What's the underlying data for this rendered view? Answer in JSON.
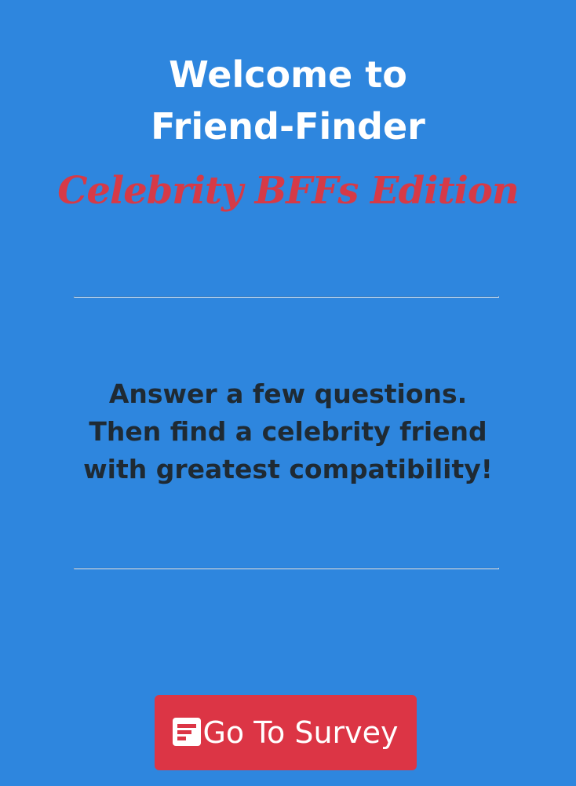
{
  "header": {
    "title_line1": "Welcome to",
    "title_line2": "Friend-Finder",
    "subtitle": "Celebrity BFFs Edition"
  },
  "main": {
    "tagline_line1": "Answer a few questions.",
    "tagline_line2": "Then find a celebrity friend",
    "tagline_line3": "with greatest compatibility!"
  },
  "cta": {
    "label": "Go To Survey",
    "icon": "survey-icon"
  },
  "colors": {
    "background": "#2e86de",
    "title": "#ffffff",
    "subtitle": "#d63a47",
    "tagline": "#1f2a33",
    "button": "#dc3545"
  }
}
